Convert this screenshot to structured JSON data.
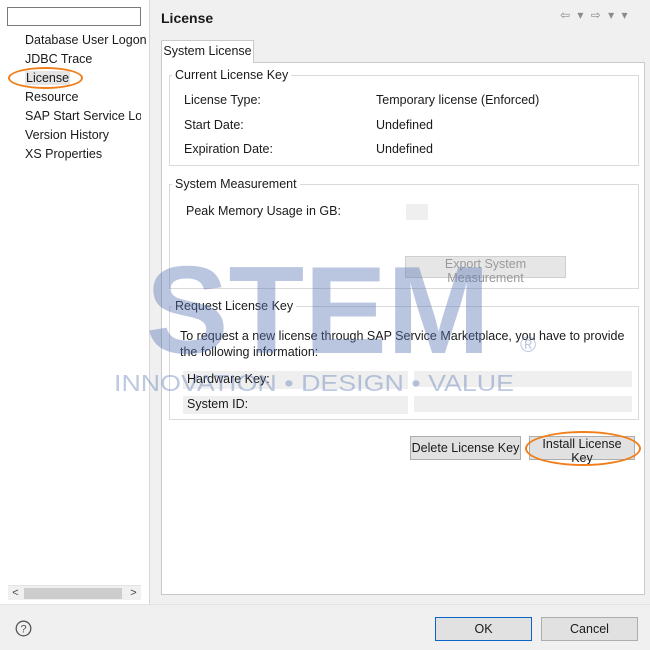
{
  "filter": {
    "value": ""
  },
  "nav": {
    "items": [
      {
        "label": "Database User Logon"
      },
      {
        "label": "JDBC Trace"
      },
      {
        "label": "License"
      },
      {
        "label": "Resource"
      },
      {
        "label": "SAP Start Service Log"
      },
      {
        "label": "Version History"
      },
      {
        "label": "XS Properties"
      }
    ],
    "selected": "License"
  },
  "page": {
    "title": "License",
    "nav_arrows": "⇦ ▾ ⇨ ▾ ▾"
  },
  "tab": {
    "label": "System License"
  },
  "current_license": {
    "title": "Current License Key",
    "type_label": "License Type:",
    "type_value": "Temporary license (Enforced)",
    "start_label": "Start Date:",
    "start_value": "Undefined",
    "expiration_label": "Expiration Date:",
    "expiration_value": "Undefined"
  },
  "measurement": {
    "title": "System Measurement",
    "peak_label": "Peak Memory Usage in GB:",
    "export_button": "Export System Measurement"
  },
  "request": {
    "title": "Request License Key",
    "instructions": "To request a new license through SAP Service Marketplace, you have to provide the following information:",
    "hardware_label": "Hardware Key:",
    "system_label": "System ID:"
  },
  "actions": {
    "delete_button": "Delete License Key",
    "install_button": "Install License Key"
  },
  "footer": {
    "ok_button": "OK",
    "cancel_button": "Cancel"
  },
  "watermark": {
    "brand": "STEM",
    "registered": "®",
    "tagline": "INNOVATION • DESIGN • VALUE"
  },
  "colors": {
    "highlight": "#f07e1a",
    "watermark": "#5b78b4",
    "primary_border": "#0a64c8"
  }
}
